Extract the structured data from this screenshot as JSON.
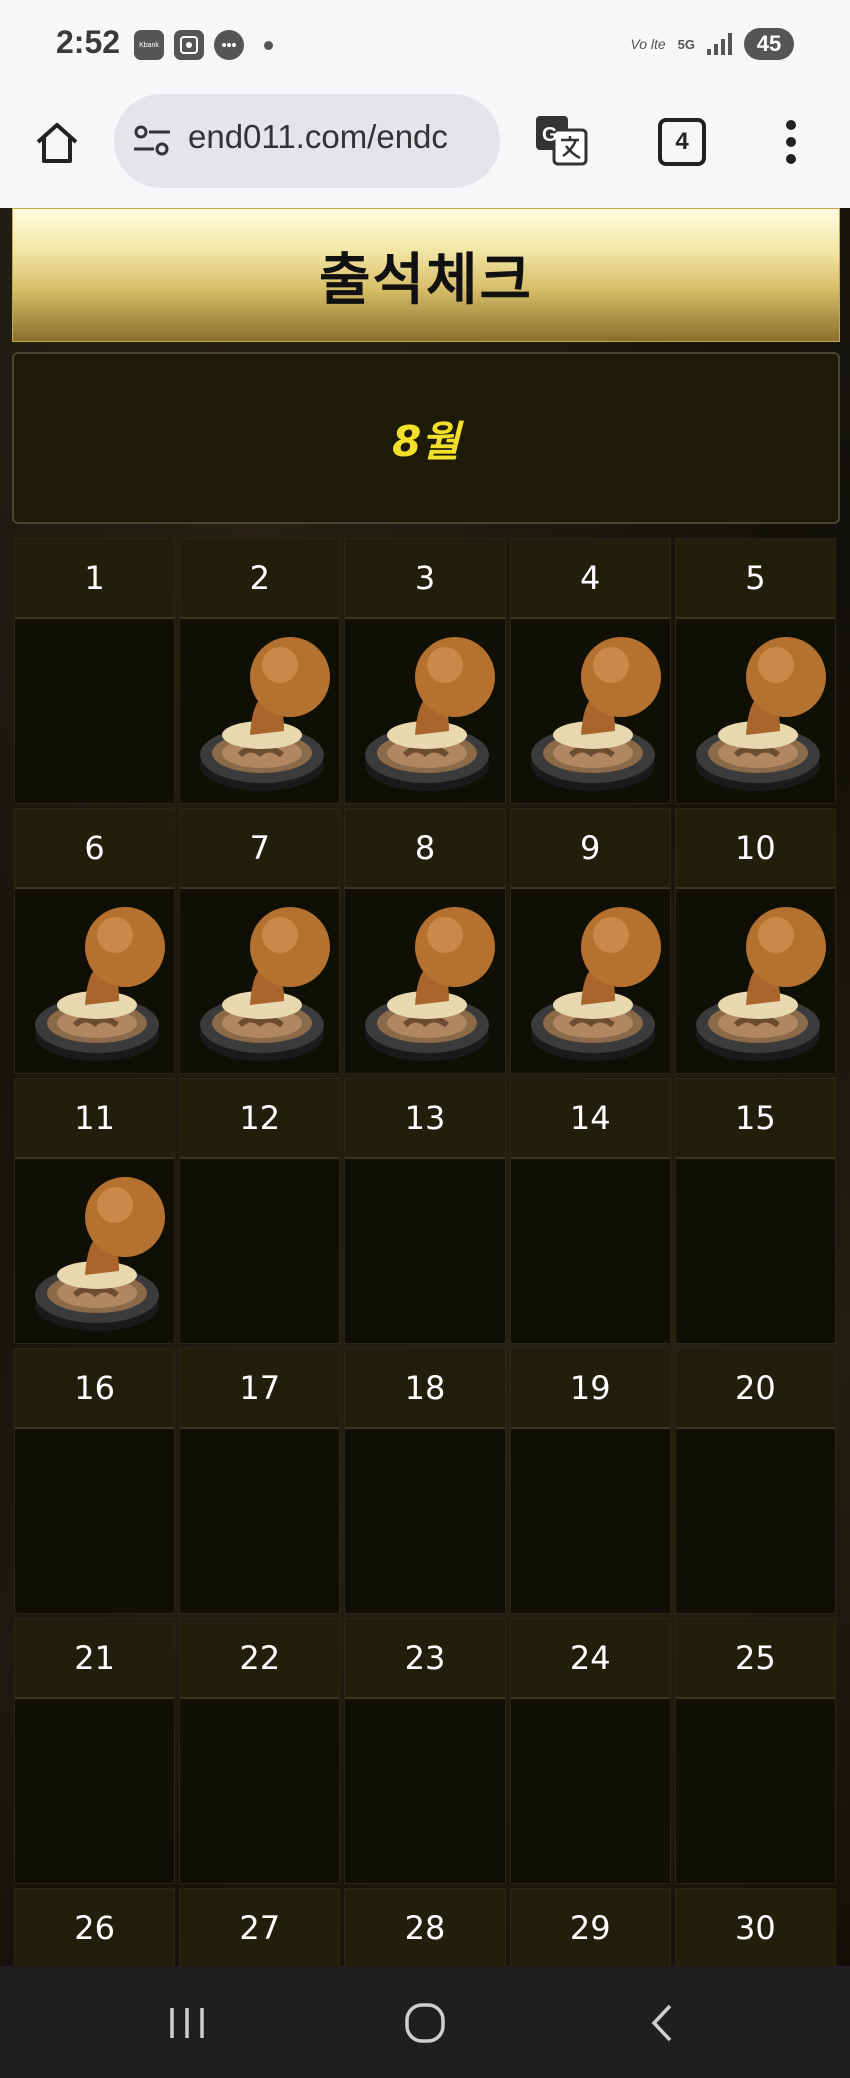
{
  "status_bar": {
    "time": "2:52",
    "app_icons": [
      "Kbank",
      "screenshot-icon",
      "chat-icon"
    ],
    "network_label": "Vo lte",
    "network_type": "5G",
    "battery": "45"
  },
  "browser": {
    "url": "end011.com/endc",
    "tab_count": "4"
  },
  "page": {
    "title": "출석체크",
    "month": "8월",
    "weeks": [
      {
        "days": [
          {
            "num": "1",
            "stamped": false
          },
          {
            "num": "2",
            "stamped": true
          },
          {
            "num": "3",
            "stamped": true
          },
          {
            "num": "4",
            "stamped": true
          },
          {
            "num": "5",
            "stamped": true
          }
        ]
      },
      {
        "days": [
          {
            "num": "6",
            "stamped": true
          },
          {
            "num": "7",
            "stamped": true
          },
          {
            "num": "8",
            "stamped": true
          },
          {
            "num": "9",
            "stamped": true
          },
          {
            "num": "10",
            "stamped": true
          }
        ]
      },
      {
        "days": [
          {
            "num": "11",
            "stamped": true
          },
          {
            "num": "12",
            "stamped": false
          },
          {
            "num": "13",
            "stamped": false
          },
          {
            "num": "14",
            "stamped": false
          },
          {
            "num": "15",
            "stamped": false
          }
        ]
      },
      {
        "days": [
          {
            "num": "16",
            "stamped": false
          },
          {
            "num": "17",
            "stamped": false
          },
          {
            "num": "18",
            "stamped": false
          },
          {
            "num": "19",
            "stamped": false
          },
          {
            "num": "20",
            "stamped": false
          }
        ]
      },
      {
        "days": [
          {
            "num": "21",
            "stamped": false
          },
          {
            "num": "22",
            "stamped": false
          },
          {
            "num": "23",
            "stamped": false
          },
          {
            "num": "24",
            "stamped": false
          },
          {
            "num": "25",
            "stamped": false
          }
        ]
      },
      {
        "days": [
          {
            "num": "26",
            "stamped": false
          },
          {
            "num": "27",
            "stamped": false
          },
          {
            "num": "28",
            "stamped": false
          },
          {
            "num": "29",
            "stamped": false
          },
          {
            "num": "30",
            "stamped": false
          }
        ]
      }
    ]
  },
  "colors": {
    "accent_gold": "#d8bf6a",
    "month_yellow": "#f4e02a",
    "badge_red": "#e8202a"
  }
}
